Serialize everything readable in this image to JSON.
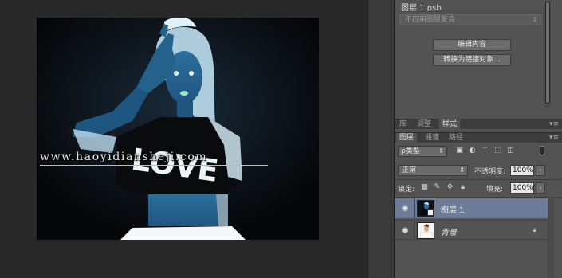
{
  "document": {
    "watermark": "www.haoyidiansheji.com",
    "shirt_text": "LOVE"
  },
  "properties": {
    "title": "图层 1.psb",
    "comp_select": "不应用图层复合",
    "edit_button": "编辑内容",
    "convert_button": "转换为链接对象..."
  },
  "top_tabs": {
    "items": [
      "库",
      "调整",
      "样式"
    ],
    "menu": "▾≡"
  },
  "layers_tabs": {
    "items": [
      "图层",
      "通道",
      "路径"
    ],
    "menu": "▾≡"
  },
  "layers": {
    "filter_kind": "ρ类型",
    "blend_mode": "正常",
    "opacity_label": "不透明度:",
    "opacity_value": "100%",
    "lock_label": "锁定:",
    "fill_label": "填充:",
    "fill_value": "100%",
    "items": [
      {
        "name": "图层 1",
        "selected": true
      },
      {
        "name": "背景",
        "locked": true
      }
    ]
  },
  "colors": {
    "panel_bg": "#535353",
    "selected_layer": "#6d7d99",
    "canvas_bg": "#050607"
  }
}
